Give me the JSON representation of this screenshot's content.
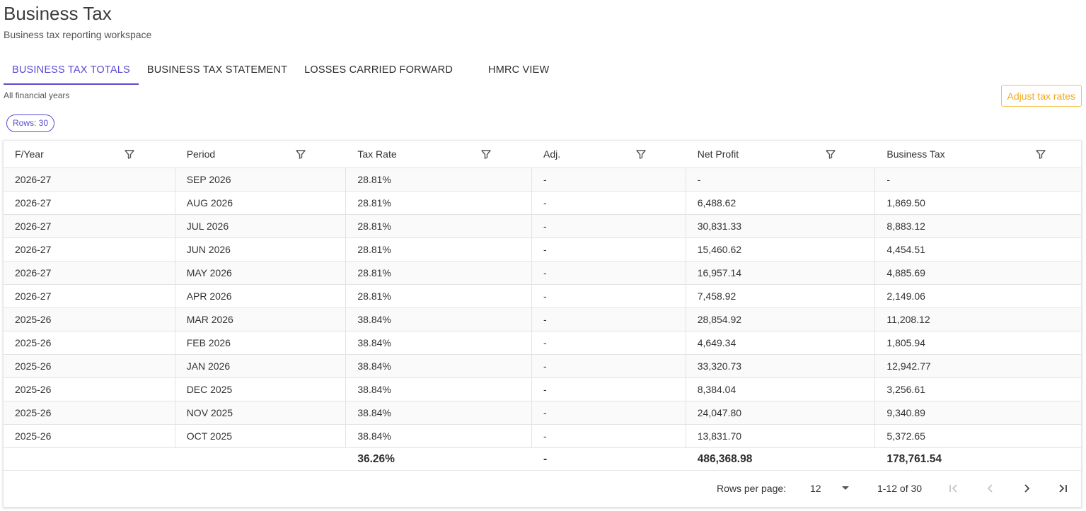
{
  "header": {
    "title": "Business Tax",
    "subtitle": "Business tax reporting workspace"
  },
  "tabs": [
    {
      "label": "BUSINESS TAX TOTALS",
      "active": true
    },
    {
      "label": "BUSINESS TAX STATEMENT",
      "active": false
    },
    {
      "label": "LOSSES CARRIED FORWARD",
      "active": false
    },
    {
      "label": "HMRC VIEW",
      "active": false
    }
  ],
  "filter_caption": "All financial years",
  "adjust_button": "Adjust tax rates",
  "rows_chip": "Rows: 30",
  "table": {
    "columns": [
      "F/Year",
      "Period",
      "Tax Rate",
      "Adj.",
      "Net Profit",
      "Business Tax"
    ],
    "rows": [
      [
        "2026-27",
        "SEP 2026",
        "28.81%",
        "-",
        "-",
        "-"
      ],
      [
        "2026-27",
        "AUG 2026",
        "28.81%",
        "-",
        "6,488.62",
        "1,869.50"
      ],
      [
        "2026-27",
        "JUL 2026",
        "28.81%",
        "-",
        "30,831.33",
        "8,883.12"
      ],
      [
        "2026-27",
        "JUN 2026",
        "28.81%",
        "-",
        "15,460.62",
        "4,454.51"
      ],
      [
        "2026-27",
        "MAY 2026",
        "28.81%",
        "-",
        "16,957.14",
        "4,885.69"
      ],
      [
        "2026-27",
        "APR 2026",
        "28.81%",
        "-",
        "7,458.92",
        "2,149.06"
      ],
      [
        "2025-26",
        "MAR 2026",
        "38.84%",
        "-",
        "28,854.92",
        "11,208.12"
      ],
      [
        "2025-26",
        "FEB 2026",
        "38.84%",
        "-",
        "4,649.34",
        "1,805.94"
      ],
      [
        "2025-26",
        "JAN 2026",
        "38.84%",
        "-",
        "33,320.73",
        "12,942.77"
      ],
      [
        "2025-26",
        "DEC 2025",
        "38.84%",
        "-",
        "8,384.04",
        "3,256.61"
      ],
      [
        "2025-26",
        "NOV 2025",
        "38.84%",
        "-",
        "24,047.80",
        "9,340.89"
      ],
      [
        "2025-26",
        "OCT 2025",
        "38.84%",
        "-",
        "13,831.70",
        "5,372.65"
      ]
    ],
    "totals": [
      "",
      "",
      "36.26%",
      "-",
      "486,368.98",
      "178,761.54"
    ]
  },
  "pager": {
    "rows_per_page_label": "Rows per page:",
    "rows_per_page": "12",
    "range": "1-12 of 30"
  },
  "colors": {
    "accent": "#5a4bd1",
    "warning": "#f2a81d"
  }
}
